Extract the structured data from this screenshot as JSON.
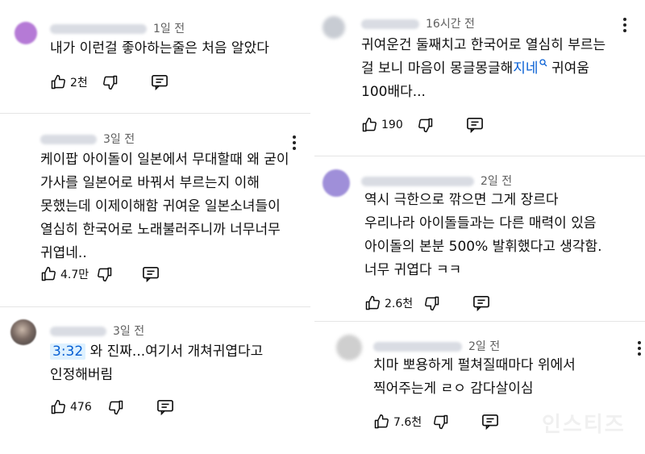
{
  "comments": [
    {
      "time": "1일 전",
      "lines": [
        "내가 이런걸 좋아하는줄은 처음 알았다"
      ],
      "likes": "2천"
    },
    {
      "time": "3일 전",
      "lines": [
        "케이팝 아이돌이 일본에서 무대할때 왜 굳이",
        "가사를 일본어로 바꿔서 부르는지 이해",
        "못했는데 이제이해함 귀여운 일본소녀들이",
        "열심히 한국어로 노래불러주니까 너무너무",
        "귀엽네.."
      ],
      "likes": "4.7만"
    },
    {
      "time": "3일 전",
      "timestamp_link": "3:32",
      "line1_rest": " 와 진짜...여기서 개쳐귀엽다고",
      "line2": "인정해버림",
      "likes": "476"
    },
    {
      "time": "16시간 전",
      "line1": "귀여운건 둘째치고 한국어로 열심히 부르는",
      "line2_pre": "걸 보니 마음이 몽글몽글해",
      "line2_link": "지네",
      "line2_post": " 귀여움",
      "line3": "100배다...",
      "likes": "190"
    },
    {
      "time": "2일 전",
      "lines": [
        "역시 극한으로 깎으면 그게 장르다",
        "우리나라 아이돌들과는 다른 매력이 있음",
        "아이돌의 본분 500% 발휘했다고 생각함.",
        "너무 귀엽다 ㅋㅋ"
      ],
      "likes": "2.6천"
    },
    {
      "time": "2일 전",
      "lines": [
        "치마 뽀용하게 펄쳐질때마다 위에서",
        "찍어주는게 ㄹㅇ 감다살이심"
      ],
      "likes": "7.6천"
    }
  ],
  "watermark": "인스티즈",
  "colors": {
    "link": "#065fd4",
    "timestamp_bg": "#def1ff",
    "meta": "#606060"
  }
}
